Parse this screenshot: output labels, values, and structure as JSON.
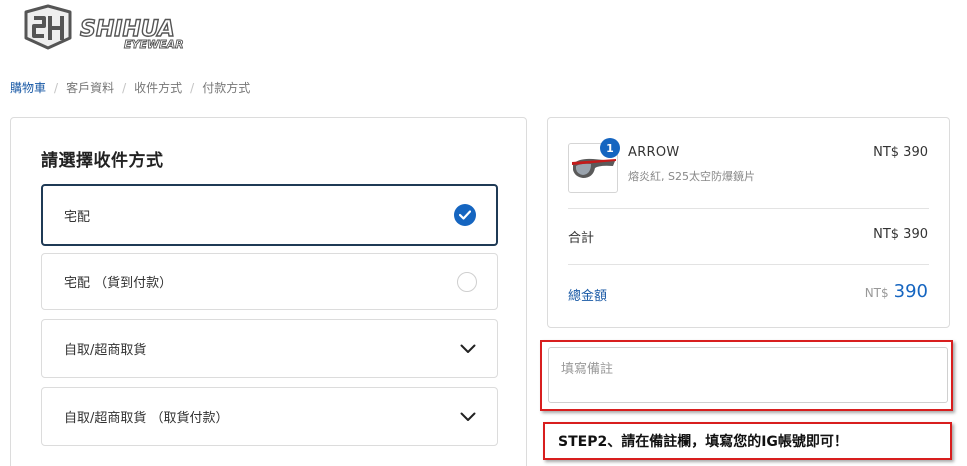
{
  "brand": {
    "logo_text": "SHIHUA",
    "logo_subtext": "EYEWEAR"
  },
  "breadcrumb": [
    {
      "label": "購物車",
      "active": true
    },
    {
      "label": "客戶資料",
      "active": false
    },
    {
      "label": "收件方式",
      "active": false
    },
    {
      "label": "付款方式",
      "active": false
    }
  ],
  "shipping": {
    "title": "請選擇收件方式",
    "options": [
      {
        "label": "宅配",
        "state": "selected",
        "icon": "check-circle-icon"
      },
      {
        "label": "宅配 （貨到付款）",
        "state": "unselected",
        "icon": "radio-icon"
      },
      {
        "label": "自取/超商取貨",
        "state": "collapsed",
        "icon": "chevron-down-icon"
      },
      {
        "label": "自取/超商取貨 （取貨付款）",
        "state": "collapsed",
        "icon": "chevron-down-icon"
      }
    ]
  },
  "summary": {
    "item": {
      "quantity": "1",
      "name": "ARROW",
      "variant": "熔炎紅, S25太空防爆鏡片",
      "price": "NT$ 390"
    },
    "subtotal_label": "合計",
    "subtotal_value": "NT$ 390",
    "total_label": "總金額",
    "total_currency": "NT$",
    "total_amount": "390"
  },
  "remarks": {
    "placeholder": "填寫備註",
    "value": ""
  },
  "annotation": {
    "text": "STEP2、請在備註欄，填寫您的IG帳號即可！"
  },
  "colors": {
    "accent": "#1565c0",
    "link": "#1a5aa6",
    "selected_border": "#1f3a55",
    "annotation_red": "#d81e1e"
  }
}
